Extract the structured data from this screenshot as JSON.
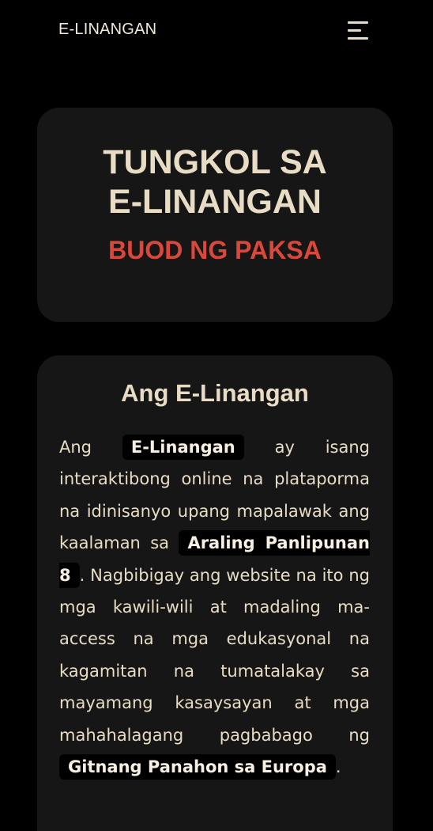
{
  "header": {
    "brand": "E-LINANGAN",
    "menu_icon": "hamburger-menu-icon"
  },
  "hero": {
    "title_line1": "TUNGKOL SA",
    "title_line2": "E-LINANGAN",
    "subtitle": "BUOD NG PAKSA"
  },
  "about": {
    "title": "Ang E-Linangan",
    "text_1": "Ang ",
    "highlight_1": "E-Linangan",
    "text_2": " ay isang interaktibong online na plataporma na idinisanyo upang mapalawak ang kaalaman sa ",
    "highlight_2": "Araling Panlipunan 8",
    "text_3": ". Nagbibigay ang website na ito ng mga kawili-wili at madaling ma-access na mga edukasyonal na kagamitan na tumatalakay sa mayamang kasaysayan at mga mahahalagang pagbabago ng ",
    "highlight_3": "Gitnang Panahon sa Europa",
    "text_4": "."
  },
  "colors": {
    "background": "#000000",
    "card": "#161616",
    "text": "#e8dcc4",
    "accent": "#d9483b"
  }
}
